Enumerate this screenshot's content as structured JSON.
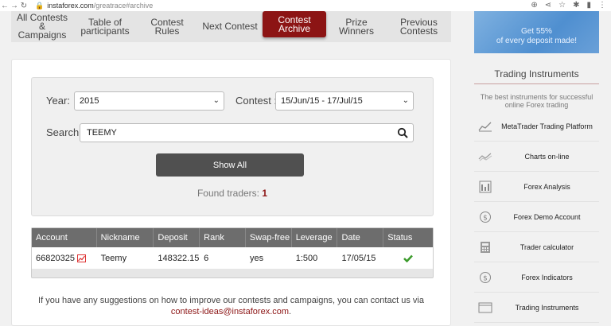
{
  "browser": {
    "url_host": "instaforex.com",
    "url_path": "/greatrace#archive"
  },
  "tabs": [
    {
      "label": "All Contests\n&\nCampaigns"
    },
    {
      "label": "Table of\nparticipants"
    },
    {
      "label": "Contest\nRules"
    },
    {
      "label": "Next Contest"
    },
    {
      "label": "Contest\nArchive",
      "active": true
    },
    {
      "label": "Prize\nWinners"
    },
    {
      "label": "Previous\nContests"
    }
  ],
  "banner": {
    "line1": "Get 55%",
    "line2": "of every deposit made!"
  },
  "form": {
    "year_label": "Year:",
    "year_value": "2015",
    "contest_label": "Contest :",
    "contest_value": "15/Jun/15 - 17/Jul/15",
    "search_label": "Search",
    "search_value": "TEEMY",
    "button_label": "Show All",
    "found_label": "Found traders:",
    "found_count": "1"
  },
  "table": {
    "headers": [
      "Account",
      "Nickname",
      "Deposit",
      "Rank",
      "Swap-free",
      "Leverage",
      "Date",
      "Status"
    ],
    "rows": [
      {
        "account": "66820325",
        "nickname": "Teemy",
        "deposit": "148322.15",
        "rank": "6",
        "swap_free": "yes",
        "leverage": "1:500",
        "date": "17/05/15"
      }
    ]
  },
  "note": {
    "text": "If you have any suggestions on how to improve our contests and campaigns, you can contact us via",
    "email": "contest-ideas@instaforex.com",
    "end": "."
  },
  "sidebar": {
    "title": "Trading Instruments",
    "subtitle": "The best instruments for successful online Forex trading",
    "items": [
      {
        "label": "MetaTrader Trading Platform",
        "icon": "platform-icon"
      },
      {
        "label": "Charts on-line",
        "icon": "chart-line-icon"
      },
      {
        "label": "Forex Analysis",
        "icon": "analysis-icon"
      },
      {
        "label": "Forex Demo Account",
        "icon": "demo-account-icon"
      },
      {
        "label": "Trader calculator",
        "icon": "calculator-icon"
      },
      {
        "label": "Forex Indicators",
        "icon": "indicators-icon"
      },
      {
        "label": "Trading Instruments",
        "icon": "instruments-icon"
      }
    ]
  }
}
